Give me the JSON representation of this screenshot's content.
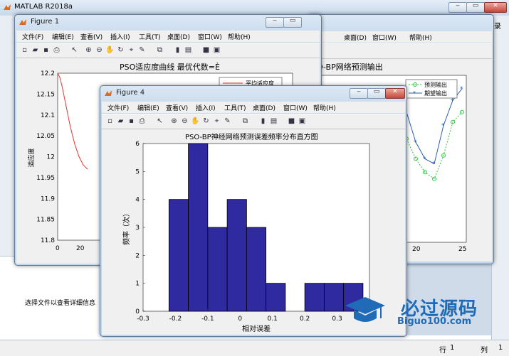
{
  "desktop": {
    "title": "MATLAB R2018a",
    "side_text": "选择文件以查看详细信息",
    "right_edge_text": "录",
    "status": {
      "row_label": "行",
      "row_value": "1",
      "col_label": "列",
      "col_value": "1"
    },
    "watermark": {
      "main": "必过源码",
      "sub": "Biguo100.com"
    }
  },
  "menu": [
    "文件(F)",
    "编辑(E)",
    "查看(V)",
    "插入(I)",
    "工具(T)",
    "桌面(D)",
    "窗口(W)",
    "帮助(H)"
  ],
  "figure1": {
    "title": "Figure 1",
    "chart_data": {
      "type": "line",
      "title": "PSO适应度曲线  最优代数=È",
      "ylabel": "适应度",
      "legend": [
        "平均适应度"
      ],
      "yticks": [
        "12.2",
        "12.15",
        "12.1",
        "12.05",
        "12",
        "11.95",
        "11.9",
        "11.85",
        "11.8"
      ],
      "xticks": [
        "0",
        "20"
      ],
      "ylim": [
        11.8,
        12.2
      ],
      "series": [
        {
          "name": "平均适应度",
          "x": [
            0,
            2,
            4,
            6,
            8,
            10,
            12,
            14,
            16,
            18,
            20,
            22,
            24,
            26,
            28
          ],
          "y": [
            12.2,
            12.19,
            12.17,
            12.145,
            12.12,
            12.095,
            12.07,
            12.05,
            12.03,
            12.015,
            12.0,
            11.99,
            11.98,
            11.975,
            11.97
          ]
        }
      ]
    }
  },
  "figure2": {
    "chart_data": {
      "type": "line",
      "title": "O-BP网络预测输出",
      "legend": [
        "预测输出",
        "期望输出"
      ],
      "xticks": [
        "20",
        "25"
      ],
      "series": [
        {
          "name": "预测输出",
          "x": [
            17,
            18,
            19,
            20,
            21,
            22,
            23,
            24,
            25
          ],
          "y": [
            0.58,
            0.55,
            0.62,
            0.5,
            0.42,
            0.38,
            0.52,
            0.72,
            0.78
          ]
        },
        {
          "name": "期望输出",
          "x": [
            17,
            18,
            19,
            20,
            21,
            22,
            23,
            24,
            25
          ],
          "y": [
            0.55,
            0.62,
            0.78,
            0.6,
            0.5,
            0.47,
            0.7,
            0.85,
            0.92
          ]
        }
      ]
    }
  },
  "figure4": {
    "title": "Figure 4",
    "chart_data": {
      "type": "bar",
      "title": "PSO-BP神经网络预测误差频率分布直方图",
      "xlabel": "相对误差",
      "ylabel": "频率（次）",
      "xticks": [
        "-0.3",
        "-0.2",
        "-0.1",
        "0",
        "0.1",
        "0.2",
        "0.3"
      ],
      "yticks": [
        "0",
        "1",
        "2",
        "3",
        "4",
        "5",
        "6"
      ],
      "xlim": [
        -0.3,
        0.4
      ],
      "ylim": [
        0,
        6
      ],
      "bin_edges": [
        -0.22,
        -0.16,
        -0.1,
        -0.04,
        0.02,
        0.08,
        0.14,
        0.2,
        0.26,
        0.32,
        0.38
      ],
      "values": [
        4,
        6,
        3,
        4,
        3,
        1,
        0,
        1,
        1,
        1
      ],
      "bar_color": "#2f2aa0"
    }
  }
}
